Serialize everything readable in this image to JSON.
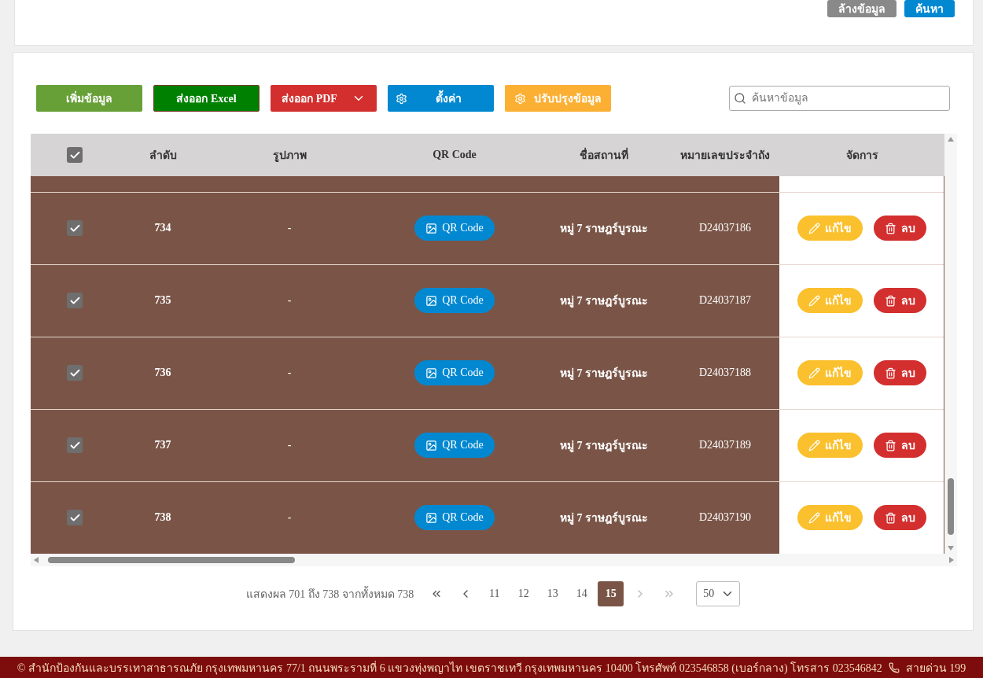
{
  "filter_actions": [
    {
      "kind": "clear",
      "label": "ล้างข้อมูล"
    },
    {
      "kind": "search",
      "label": "ค้นหา"
    }
  ],
  "toolbar": [
    {
      "kind": "add",
      "label": "เพิ่มข้อมูล"
    },
    {
      "kind": "excel",
      "label": "ส่งออก Excel"
    },
    {
      "kind": "pdf",
      "label": "ส่งออก PDF"
    },
    {
      "kind": "settings",
      "label": "ตั้งค่า"
    },
    {
      "kind": "update",
      "label": "ปรับปรุงข้อมูล"
    }
  ],
  "search": {
    "placeholder": "ค้นหาข้อมูล"
  },
  "table": {
    "select_all": {
      "checked": true
    },
    "columns": [
      "ลำดับ",
      "รูปภาพ",
      "QR Code",
      "ชื่อสถานที่",
      "หมายเลขประจำถัง",
      "จัดการ"
    ],
    "rows": [
      {
        "checked": true,
        "index": "734",
        "image": "-",
        "qr": "QR Code",
        "name": "หมู่ 7 ราษฎร์บูรณะ",
        "code": "D24037186",
        "edit": "แก้ไข",
        "delete": "ลบ"
      },
      {
        "checked": true,
        "index": "735",
        "image": "-",
        "qr": "QR Code",
        "name": "หมู่ 7 ราษฎร์บูรณะ",
        "code": "D24037187",
        "edit": "แก้ไข",
        "delete": "ลบ"
      },
      {
        "checked": true,
        "index": "736",
        "image": "-",
        "qr": "QR Code",
        "name": "หมู่ 7 ราษฎร์บูรณะ",
        "code": "D24037188",
        "edit": "แก้ไข",
        "delete": "ลบ"
      },
      {
        "checked": true,
        "index": "737",
        "image": "-",
        "qr": "QR Code",
        "name": "หมู่ 7 ราษฎร์บูรณะ",
        "code": "D24037189",
        "edit": "แก้ไข",
        "delete": "ลบ"
      },
      {
        "checked": true,
        "index": "738",
        "image": "-",
        "qr": "QR Code",
        "name": "หมู่ 7 ราษฎร์บูรณะ",
        "code": "D24037190",
        "edit": "แก้ไข",
        "delete": "ลบ"
      }
    ]
  },
  "pagination": {
    "summary": "แสดงผล 701 ถึง 738 จากทั้งหมด 738",
    "nav_before": [
      {
        "kind": "first",
        "disabled": false
      },
      {
        "kind": "prev",
        "disabled": false
      }
    ],
    "pages": [
      {
        "label": "11",
        "selected": false
      },
      {
        "label": "12",
        "selected": false
      },
      {
        "label": "13",
        "selected": false
      },
      {
        "label": "14",
        "selected": false
      },
      {
        "label": "15",
        "selected": true
      }
    ],
    "nav_after": [
      {
        "kind": "next",
        "disabled": true
      },
      {
        "kind": "last",
        "disabled": true
      }
    ],
    "page_size": "50"
  },
  "footer": {
    "text": "© สำนักป้องกันและบรรเทาสาธารณภัย กรุงเทพมหานคร 77/1 ถนนพระรามที่ 6 แขวงทุ่งพญาไท เขตราชเทวี กรุงเทพมหานคร 10400 โทรศัพท์ 023546858 (เบอร์กลาง) โทรสาร 023546842",
    "hotline": "สายด่วน 199"
  }
}
